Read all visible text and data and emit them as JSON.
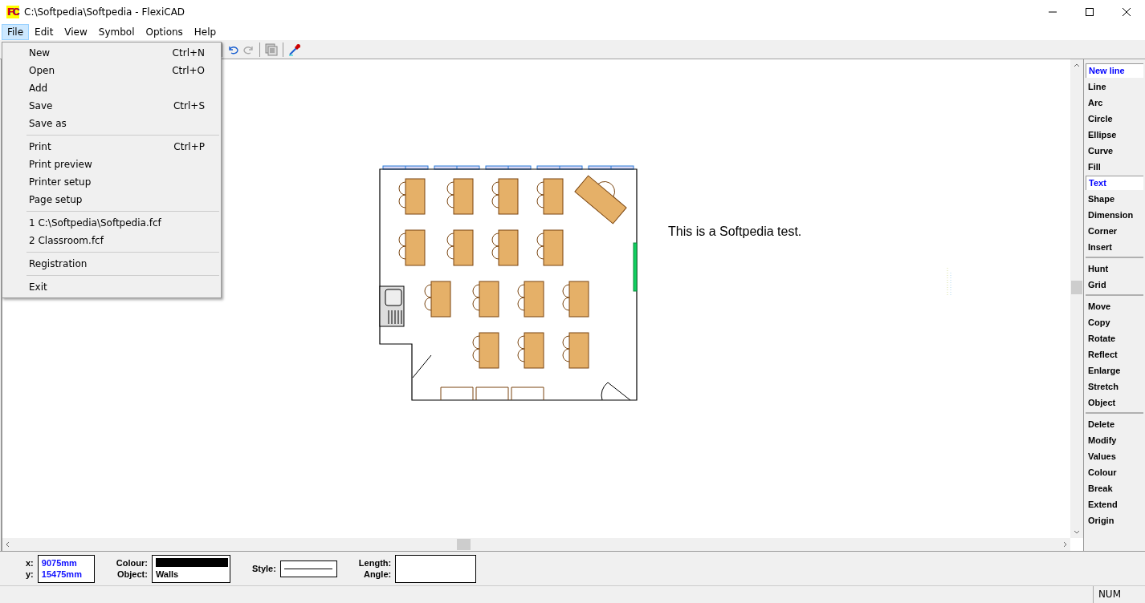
{
  "window": {
    "title": "C:\\Softpedia\\Softpedia - FlexiCAD",
    "logo": "FC"
  },
  "menubar": [
    {
      "label": "File",
      "selected": true
    },
    {
      "label": "Edit",
      "selected": false
    },
    {
      "label": "View",
      "selected": false
    },
    {
      "label": "Symbol",
      "selected": false
    },
    {
      "label": "Options",
      "selected": false
    },
    {
      "label": "Help",
      "selected": false
    }
  ],
  "file_menu": [
    [
      {
        "label": "New",
        "shortcut": "Ctrl+N"
      },
      {
        "label": "Open",
        "shortcut": "Ctrl+O"
      },
      {
        "label": "Add"
      },
      {
        "label": "Save",
        "shortcut": "Ctrl+S"
      },
      {
        "label": "Save as"
      }
    ],
    [
      {
        "label": "Print",
        "shortcut": "Ctrl+P"
      },
      {
        "label": "Print preview"
      },
      {
        "label": "Printer setup"
      },
      {
        "label": "Page setup"
      }
    ],
    [
      {
        "label": "1 C:\\Softpedia\\Softpedia.fcf"
      },
      {
        "label": "2 Classroom.fcf"
      }
    ],
    [
      {
        "label": "Registration"
      }
    ],
    [
      {
        "label": "Exit"
      }
    ]
  ],
  "canvas": {
    "text": "This is a Softpedia test."
  },
  "commands": [
    [
      {
        "label": "New line",
        "selected": true
      },
      {
        "label": "Line",
        "selected": false
      },
      {
        "label": "Arc",
        "selected": false
      },
      {
        "label": "Circle",
        "selected": false
      },
      {
        "label": "Ellipse",
        "selected": false
      },
      {
        "label": "Curve",
        "selected": false
      },
      {
        "label": "Fill",
        "selected": false
      },
      {
        "label": "Text",
        "selected": true
      },
      {
        "label": "Shape",
        "selected": false
      },
      {
        "label": "Dimension",
        "selected": false
      },
      {
        "label": "Corner",
        "selected": false
      },
      {
        "label": "Insert",
        "selected": false
      }
    ],
    [
      {
        "label": "Hunt",
        "selected": false
      },
      {
        "label": "Grid",
        "selected": false
      }
    ],
    [
      {
        "label": "Move",
        "selected": false
      },
      {
        "label": "Copy",
        "selected": false
      },
      {
        "label": "Rotate",
        "selected": false
      },
      {
        "label": "Reflect",
        "selected": false
      },
      {
        "label": "Enlarge",
        "selected": false
      },
      {
        "label": "Stretch",
        "selected": false
      },
      {
        "label": "Object",
        "selected": false
      }
    ],
    [
      {
        "label": "Delete",
        "selected": false
      },
      {
        "label": "Modify",
        "selected": false
      },
      {
        "label": "Values",
        "selected": false
      },
      {
        "label": "Colour",
        "selected": false
      },
      {
        "label": "Break",
        "selected": false
      },
      {
        "label": "Extend",
        "selected": false
      },
      {
        "label": "Origin",
        "selected": false
      }
    ]
  ],
  "info": {
    "x_label": "x:",
    "x_value": "9075mm",
    "y_label": "y:",
    "y_value": "15475mm",
    "colour_label": "Colour:",
    "object_label": "Object:",
    "object_value": "Walls",
    "style_label": "Style:",
    "length_label": "Length:",
    "angle_label": "Angle:"
  },
  "status_bar": {
    "indicator": "NUM"
  }
}
